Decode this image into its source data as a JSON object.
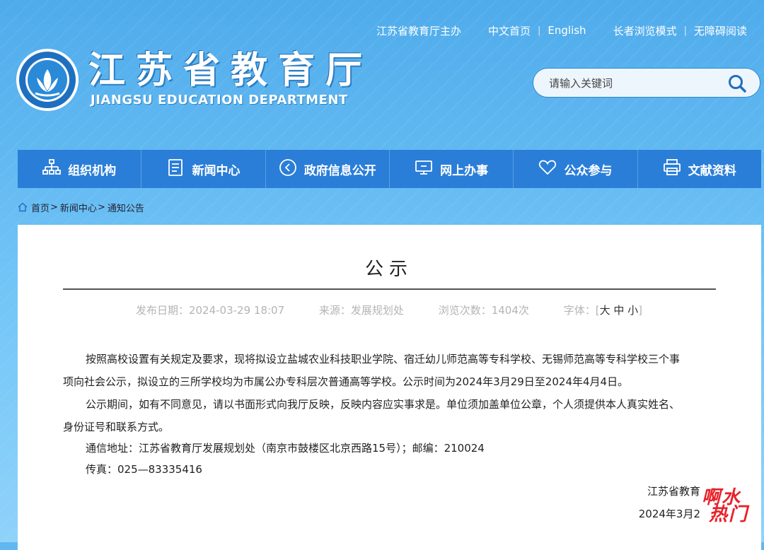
{
  "header": {
    "top_links": {
      "sponsor": "江苏省教育厅主办",
      "chinese_home": "中文首页",
      "english": "English",
      "elder_mode": "长者浏览模式",
      "accessible_mode": "无障碍阅读"
    },
    "title": "江苏省教育厅",
    "subtitle": "JIANGSU EDUCATION DEPARTMENT",
    "search_placeholder": "请输入关键词"
  },
  "nav": {
    "items": [
      {
        "label": "组织机构",
        "icon": "org-chart-icon"
      },
      {
        "label": "新闻中心",
        "icon": "document-icon"
      },
      {
        "label": "政府信息公开",
        "icon": "compass-icon"
      },
      {
        "label": "网上办事",
        "icon": "monitor-icon"
      },
      {
        "label": "公众参与",
        "icon": "heart-icon"
      },
      {
        "label": "文献资料",
        "icon": "printer-icon"
      }
    ]
  },
  "breadcrumb": {
    "home": "首页",
    "news": "新闻中心",
    "notice": "通知公告",
    "arrow": ">"
  },
  "article": {
    "title": "公示",
    "date_label": "发布日期：2024-03-29 18:07",
    "source_label": "来源：发展规划处",
    "views_label": "浏览次数：1404次",
    "font_label": "字体：",
    "font_big": "大",
    "font_mid": "中",
    "font_small": "小",
    "bracket_l": "[",
    "bracket_r": "]",
    "p1_line1": "按照高校设置有关规定及要求，现将拟设立盐城农业科技职业学院、宿迁幼儿师范高等专科学校、无锡师范高等专科学校三个事",
    "p1_line2": "项向社会公示，拟设立的三所学校均为市属公办专科层次普通高等学校。公示时间为2024年3月29日至2024年4月4日。",
    "p2_line1": "公示期间，如有不同意见，请以书面形式向我厅反映，反映内容应实事求是。单位须加盖单位公章，个人须提供本人真实姓名、",
    "p2_line2": "身份证号和联系方式。",
    "address": "通信地址：江苏省教育厅发展规划处（南京市鼓楼区北京西路15号）；邮编：210024",
    "fax": "传真：025—83335416",
    "signer": "江苏省教育",
    "sign_date": "2024年3月2"
  },
  "watermark": {
    "line1": "啊水",
    "line2": "热门"
  },
  "colors": {
    "nav_bg": "#2a7ed8",
    "header_bg": "#61b8f0",
    "watermark": "#e8212a"
  }
}
